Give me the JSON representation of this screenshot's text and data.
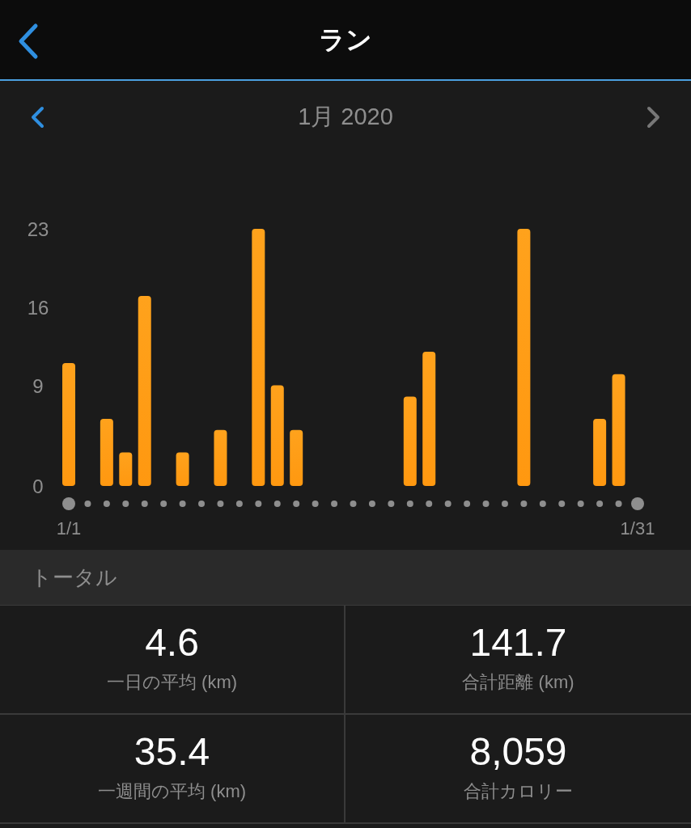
{
  "header": {
    "title": "ラン"
  },
  "month_nav": {
    "label": "1月 2020"
  },
  "chart": {
    "chart_data": {
      "type": "bar",
      "categories": [
        "1/1",
        null,
        null,
        null,
        null,
        null,
        null,
        null,
        null,
        null,
        null,
        null,
        null,
        null,
        null,
        null,
        null,
        null,
        null,
        null,
        null,
        null,
        null,
        null,
        null,
        null,
        null,
        null,
        null,
        null,
        "1/31"
      ],
      "values": [
        11,
        0,
        6,
        3,
        17,
        0,
        3,
        0,
        5,
        0,
        23,
        9,
        5,
        0,
        0,
        0,
        0,
        0,
        8,
        12,
        0,
        0,
        0,
        0,
        23,
        0,
        0,
        0,
        6,
        10,
        0
      ],
      "ylim": [
        0,
        23
      ],
      "yticks": [
        {
          "value": 0,
          "label": "0"
        },
        {
          "value": 9,
          "label": "9"
        },
        {
          "value": 16,
          "label": "16"
        },
        {
          "value": 23,
          "label": "23"
        }
      ]
    }
  },
  "totals": {
    "title": "トータル",
    "stats": [
      {
        "value": "4.6",
        "label": "一日の平均 (km)"
      },
      {
        "value": "141.7",
        "label": "合計距離 (km)"
      },
      {
        "value": "35.4",
        "label": "一週間の平均 (km)"
      },
      {
        "value": "8,059",
        "label": "合計カロリー"
      }
    ]
  }
}
